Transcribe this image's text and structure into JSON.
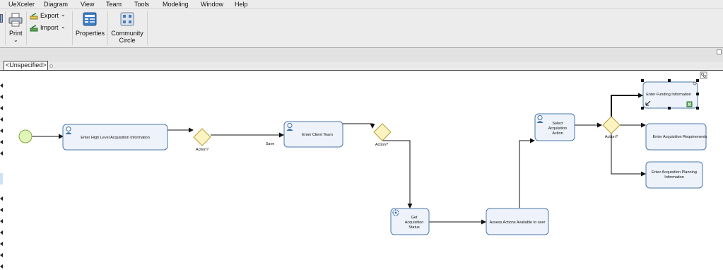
{
  "menubar": {
    "items": [
      "UeXceler",
      "Diagram",
      "View",
      "Team",
      "Tools",
      "Modeling",
      "Window",
      "Help"
    ]
  },
  "toolbar": {
    "print_label": "Print",
    "export_label": "Export",
    "import_label": "Import",
    "properties_label": "Properties",
    "community_line1": "Community",
    "community_line2": "Circle"
  },
  "tab": {
    "label": "<Unspecified>"
  },
  "colors": {
    "task_fill": "#eef2fa",
    "task_border": "#4a78a8",
    "gateway_fill": "#fbf4c0",
    "gateway_border": "#b89c3c",
    "start_fill": "#e2f5b8",
    "start_border": "#7ea83a",
    "user_icon": "#3a6ea5"
  },
  "diagram": {
    "start_event": "start-event",
    "tasks": {
      "enter_high_level": "Enter High Level Acquisition Information",
      "enter_client_team": "Enter Client Team",
      "get_acquisition_status": [
        "Get",
        "Acquisition",
        "Status"
      ],
      "assess_actions": "Assess Actions Available to user",
      "select_action": [
        "Select",
        "Acquisition",
        "Action"
      ],
      "enter_funding": "Enter Funding Information",
      "enter_requirements": "Enter Acquisition Requirements",
      "enter_planning": [
        "Enter Acquisition Planning",
        "Information"
      ]
    },
    "gateways": {
      "gw1": "Action?",
      "gw2": "Action?",
      "gw3": "Action?"
    },
    "flow_labels": {
      "save": "Save"
    }
  }
}
